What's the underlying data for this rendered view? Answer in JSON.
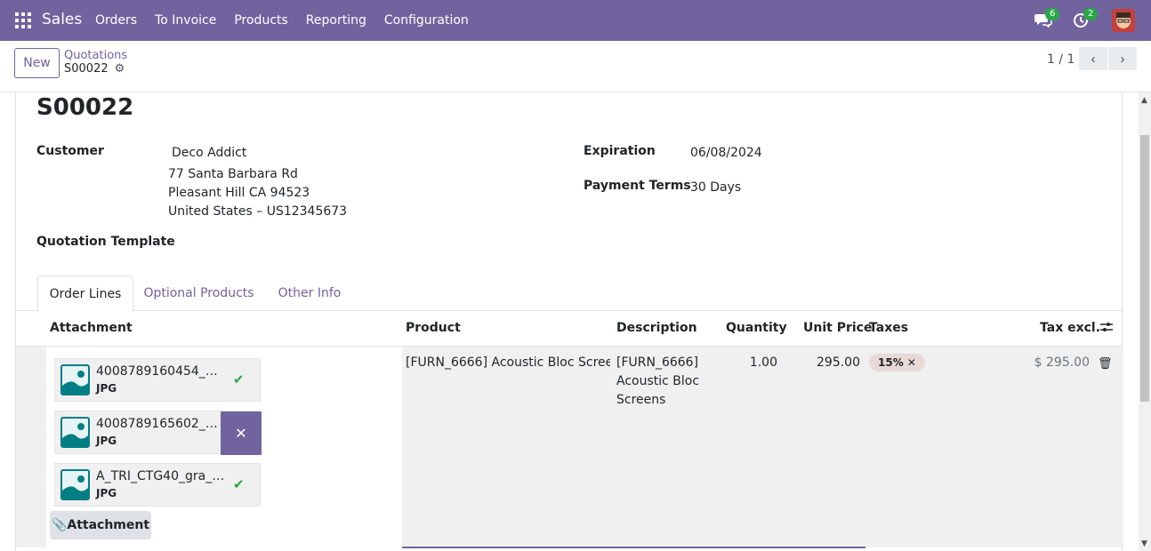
{
  "navbar": {
    "app_name": "Sales",
    "menu": [
      "Orders",
      "To Invoice",
      "Products",
      "Reporting",
      "Configuration"
    ],
    "messages_count": "6",
    "activities_count": "2"
  },
  "control": {
    "new_label": "New",
    "breadcrumb": "Quotations",
    "record": "S00022",
    "pager": "1 / 1"
  },
  "form": {
    "title": "S00022",
    "customer_label": "Customer",
    "customer_name": "Deco Addict",
    "address_line1": "77 Santa Barbara Rd",
    "address_line2": "Pleasant Hill CA 94523",
    "address_line3": "United States – US12345673",
    "template_label": "Quotation Template",
    "expiration_label": "Expiration",
    "expiration_value": "06/08/2024",
    "payment_terms_label": "Payment Terms",
    "payment_terms_value": "30 Days"
  },
  "tabs": [
    "Order Lines",
    "Optional Products",
    "Other Info"
  ],
  "table": {
    "headers": {
      "attachment": "Attachment",
      "product": "Product",
      "description": "Description",
      "quantity": "Quantity",
      "unit_price": "Unit Price",
      "taxes": "Taxes",
      "tax_excl": "Tax excl."
    },
    "line": {
      "product": "[FURN_6666] Acoustic Bloc Scree",
      "description_1": "[FURN_6666]",
      "description_2": "Acoustic Bloc",
      "description_3": "Screens",
      "quantity": "1.00",
      "unit_price": "295.00",
      "tax": "15%",
      "subtotal": "$ 295.00"
    },
    "attachments": [
      {
        "name": "4008789160454_CL...",
        "type": "JPG"
      },
      {
        "name": "4008789165602_CU...",
        "type": "JPG"
      },
      {
        "name": "A_TRI_CTG40_gra_S...",
        "type": "JPG"
      }
    ],
    "attachment_button": "Attachment"
  },
  "colors": {
    "brand": "#71639e",
    "success": "#28a745"
  }
}
